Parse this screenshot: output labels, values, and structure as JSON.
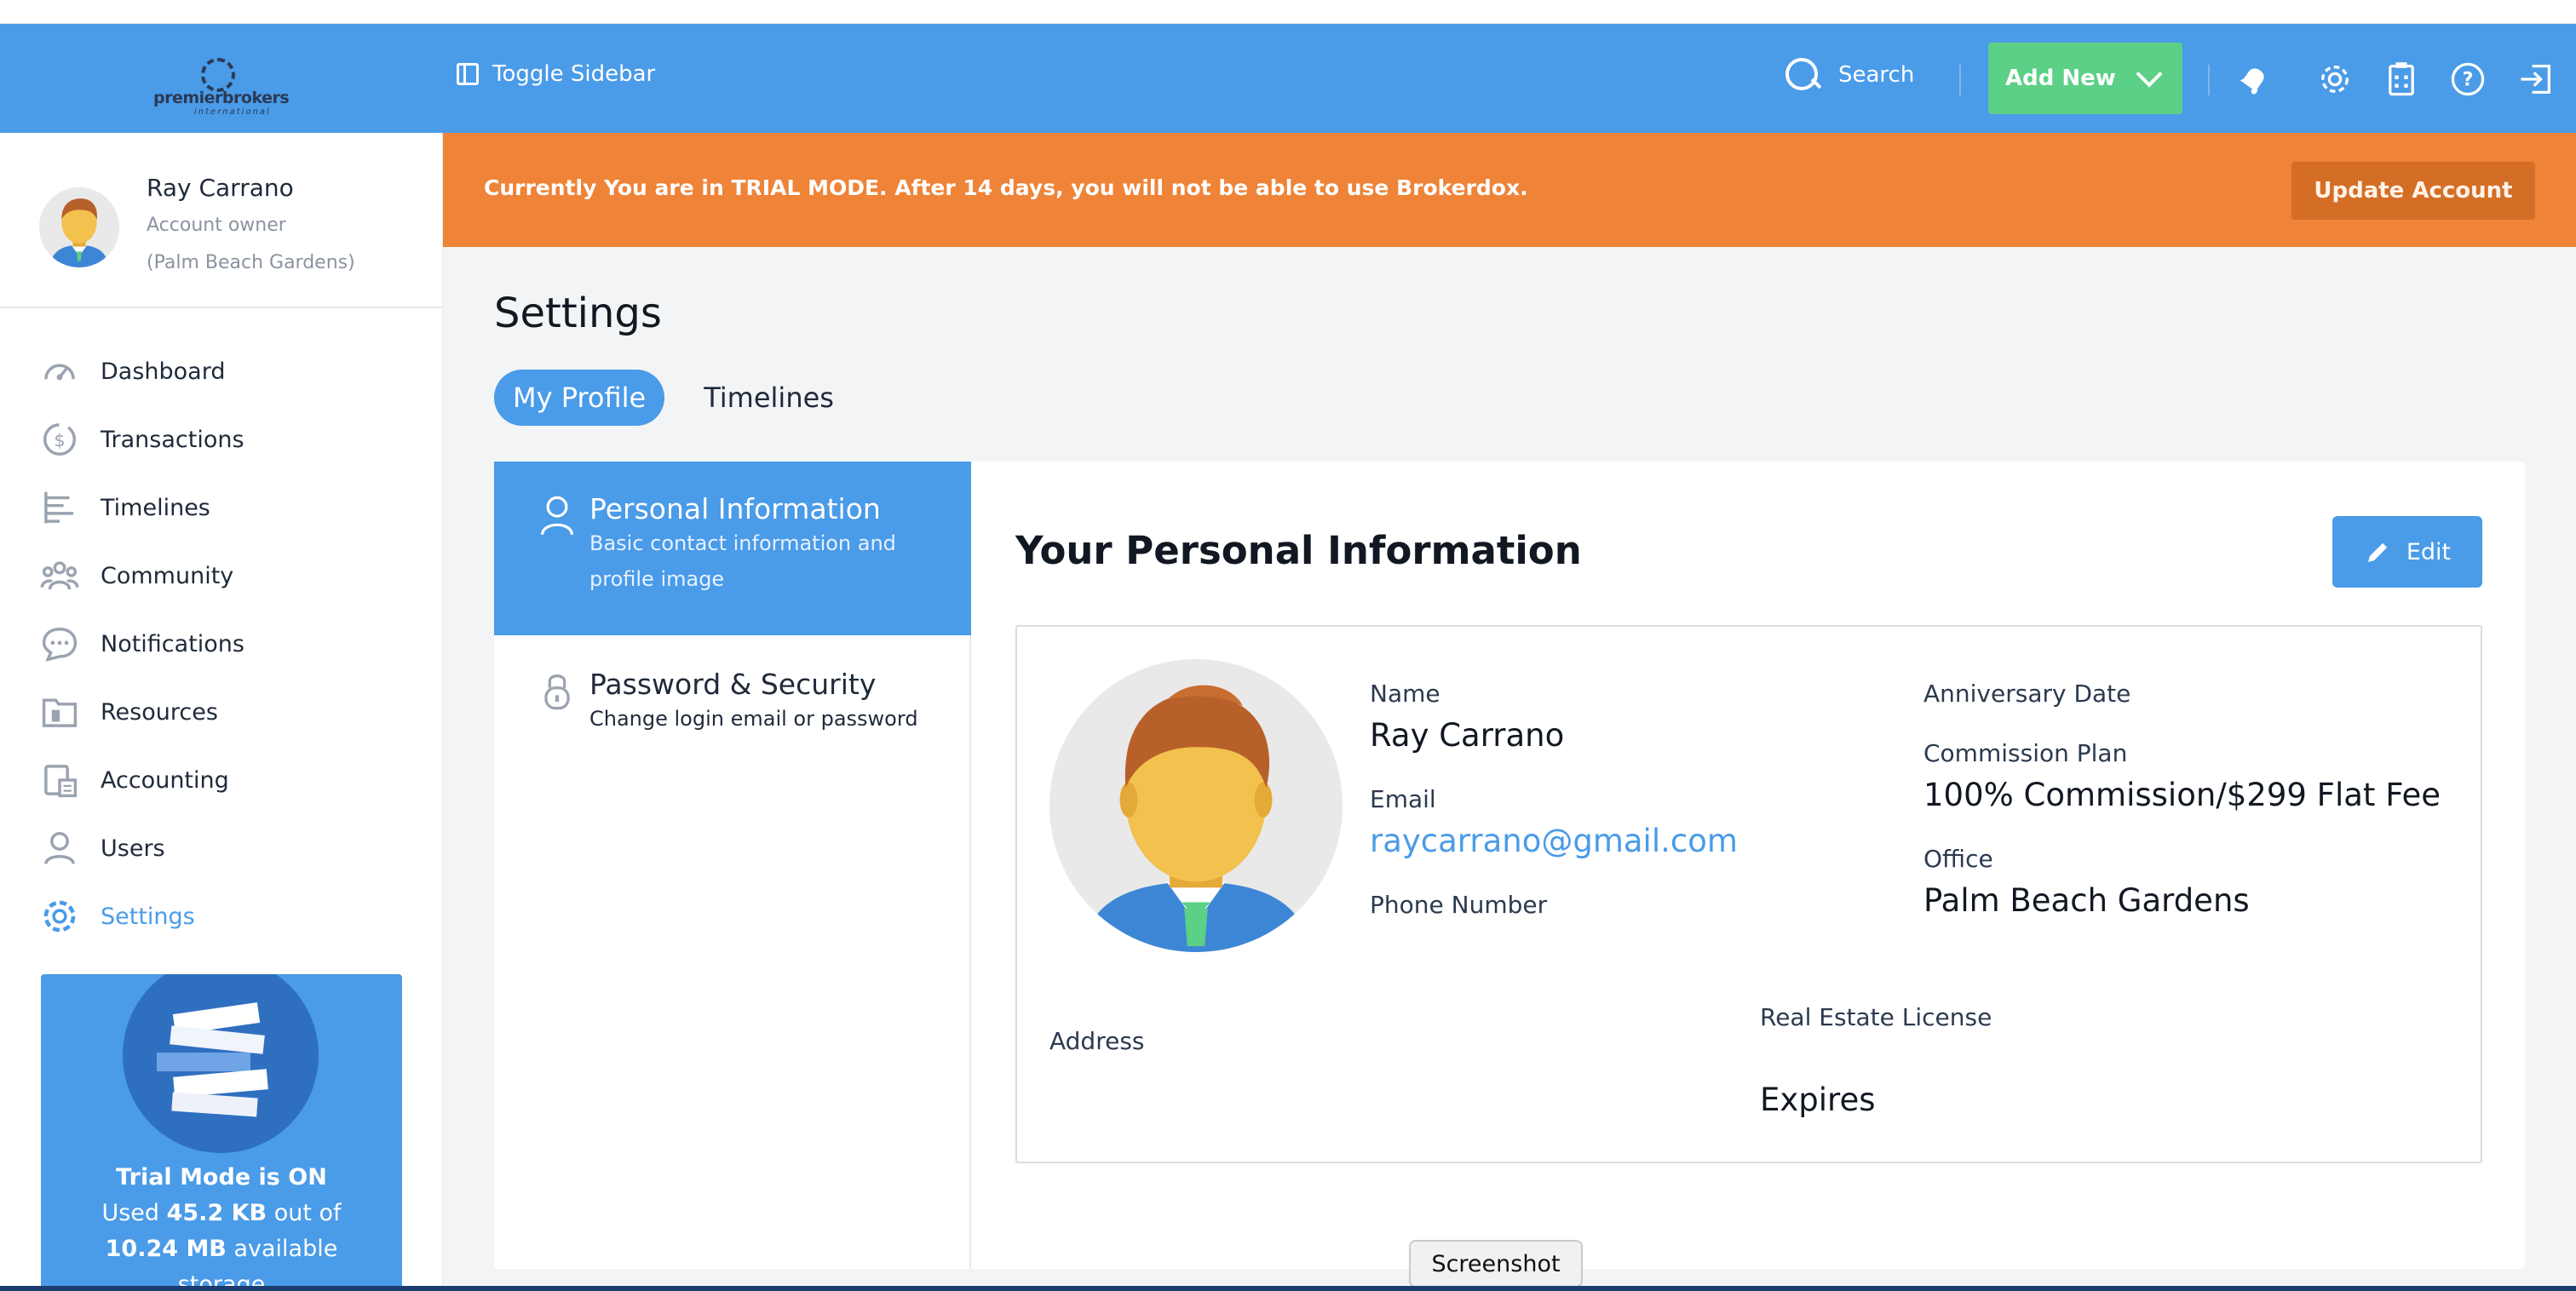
{
  "topbar": {
    "logo_text": "premierbrokers",
    "logo_sub": "international",
    "toggle_label": "Toggle Sidebar",
    "search_label": "Search",
    "add_new_label": "Add New"
  },
  "user": {
    "name": "Ray Carrano",
    "role": "Account owner",
    "office": "(Palm Beach Gardens)"
  },
  "nav": {
    "items": [
      {
        "label": "Dashboard",
        "icon": "speedometer-icon"
      },
      {
        "label": "Transactions",
        "icon": "dollar-icon"
      },
      {
        "label": "Timelines",
        "icon": "timeline-icon"
      },
      {
        "label": "Community",
        "icon": "people-icon"
      },
      {
        "label": "Notifications",
        "icon": "chat-bubble-icon"
      },
      {
        "label": "Resources",
        "icon": "folder-icon"
      },
      {
        "label": "Accounting",
        "icon": "calculator-icon"
      },
      {
        "label": "Users",
        "icon": "user-icon"
      },
      {
        "label": "Settings",
        "icon": "gear-icon",
        "active": true
      }
    ]
  },
  "trial": {
    "line1": "Trial Mode is ON",
    "used_prefix": "Used ",
    "used": "45.2 KB",
    "used_suffix": " out of",
    "total": "10.24 MB",
    "total_suffix": " available",
    "line4": "storage"
  },
  "banner": {
    "message": "Currently You are in TRIAL MODE. After 14 days, you will not be able to use Brokerdox.",
    "button": "Update Account"
  },
  "page": {
    "title": "Settings",
    "tabs": [
      "My Profile",
      "Timelines"
    ]
  },
  "settings_menu": {
    "personal": {
      "title": "Personal Information",
      "desc1": "Basic contact information and",
      "desc2": "profile image"
    },
    "security": {
      "title": "Password & Security",
      "desc": "Change login email or password"
    }
  },
  "personal_info": {
    "heading": "Your Personal Information",
    "edit_label": "Edit",
    "fields": {
      "name_label": "Name",
      "name_value": "Ray Carrano",
      "email_label": "Email",
      "email_value": "raycarrano@gmail.com",
      "phone_label": "Phone Number",
      "anniversary_label": "Anniversary Date",
      "commission_label": "Commission Plan",
      "commission_value": "100% Commission/$299 Flat Fee",
      "office_label": "Office",
      "office_value": "Palm Beach Gardens",
      "address_label": "Address",
      "license_label": "Real Estate License",
      "expires_label": "Expires"
    }
  },
  "tooltip": {
    "label": "Screenshot"
  },
  "colors": {
    "primary": "#4a9be8",
    "success": "#5bd086",
    "warning": "#ef8337"
  }
}
